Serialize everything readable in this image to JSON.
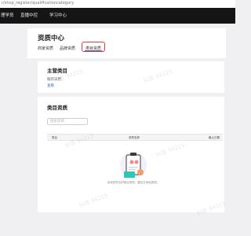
{
  "browser": {
    "url": "r/shop_register/qualificationcategory"
  },
  "topnav": {
    "items": [
      "理学员",
      "直播中控",
      "学习中心"
    ]
  },
  "page": {
    "title": "资质中心",
    "tabs": [
      {
        "label": "商家资质",
        "active": false
      },
      {
        "label": "品牌资质",
        "active": false
      },
      {
        "label": "类目资质",
        "active": true
      }
    ]
  },
  "main_category": {
    "title": "主营类目",
    "label": "服装日用",
    "link": "查看"
  },
  "category_qualification": {
    "title": "类目资质",
    "search_placeholder": "搜索类目",
    "columns": [
      "类目",
      "资质名称",
      "截止日期"
    ],
    "empty_text": "未找到符合的类目资质，建议去添加资质。"
  },
  "watermark": {
    "text": "抖音 94215"
  },
  "colors": {
    "nav_bg": "#151515",
    "accent": "#2f6fe5",
    "highlight": "#e63b3b"
  }
}
